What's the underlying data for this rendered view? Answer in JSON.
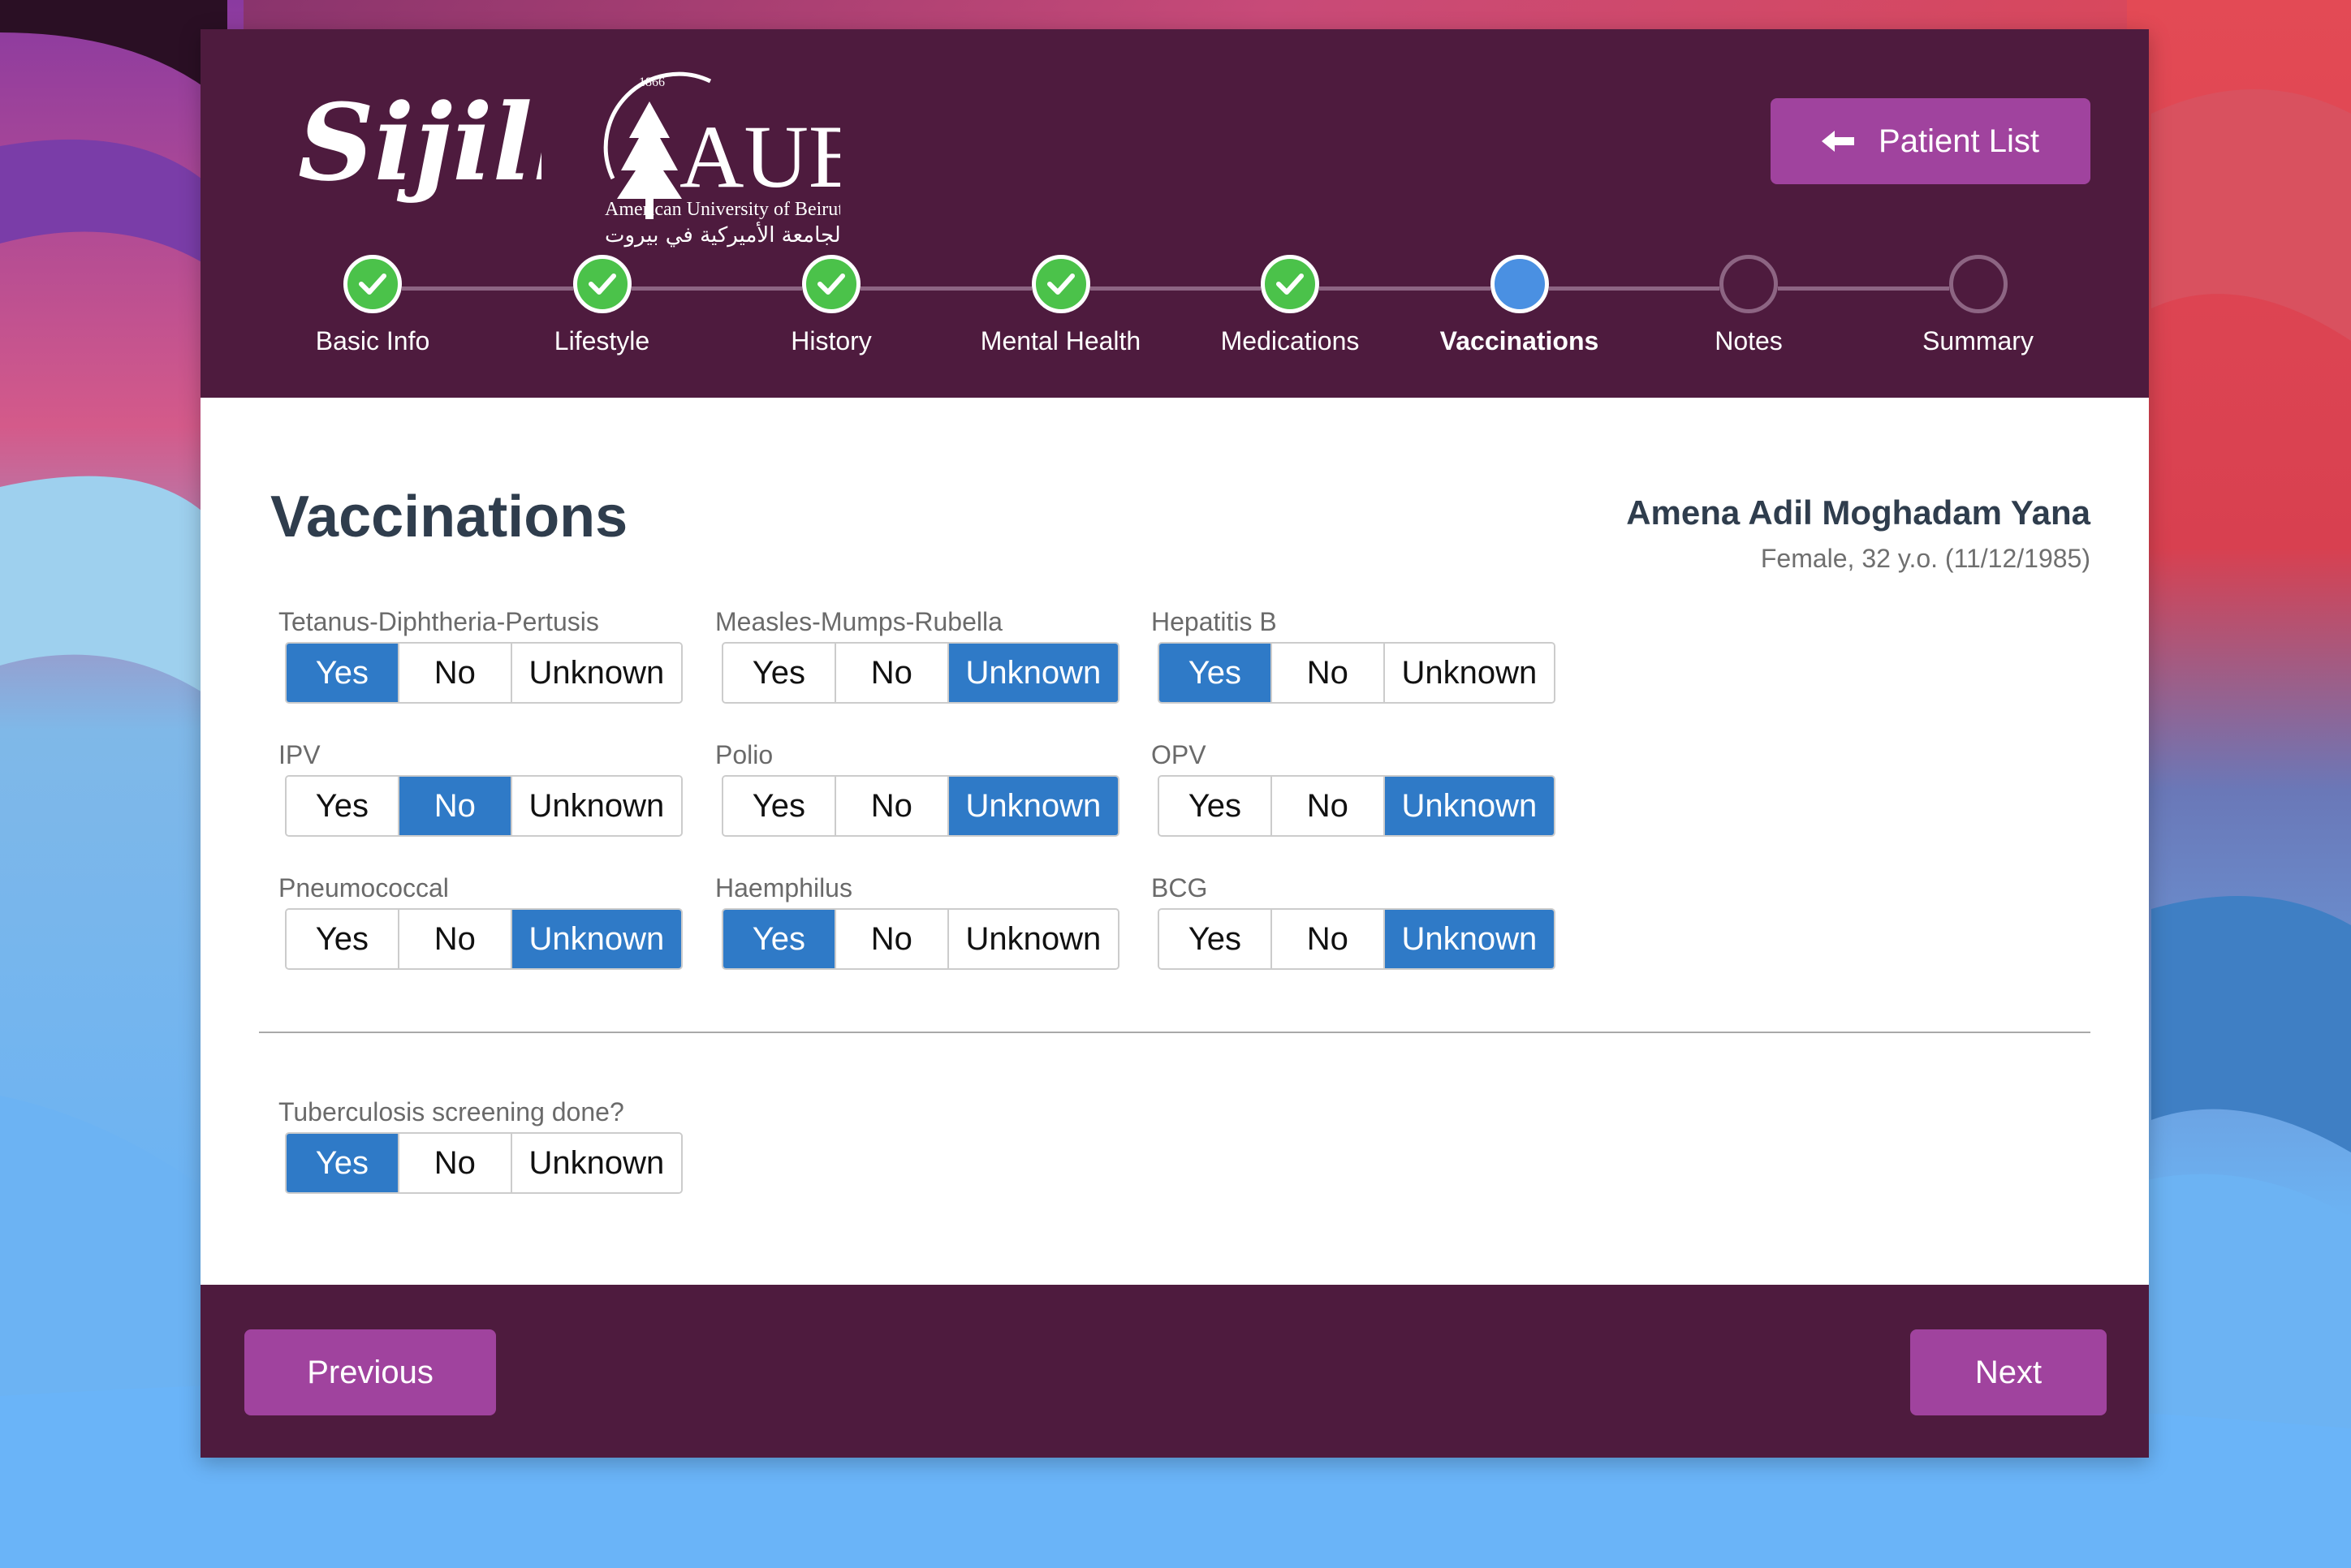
{
  "header": {
    "brand_sijilli": "Sijilli",
    "aub_year": "1866",
    "aub_name": "AUB",
    "aub_full": "American University of Beirut",
    "aub_arabic": "الجامعة الأميركية في بيروت",
    "patient_list_label": "Patient List"
  },
  "steps": [
    {
      "label": "Basic Info",
      "state": "done"
    },
    {
      "label": "Lifestyle",
      "state": "done"
    },
    {
      "label": "History",
      "state": "done"
    },
    {
      "label": "Mental Health",
      "state": "done"
    },
    {
      "label": "Medications",
      "state": "done"
    },
    {
      "label": "Vaccinations",
      "state": "active"
    },
    {
      "label": "Notes",
      "state": "todo"
    },
    {
      "label": "Summary",
      "state": "todo"
    }
  ],
  "page": {
    "title": "Vaccinations",
    "patient_name": "Amena Adil Moghadam Yana",
    "patient_info": "Female, 32 y.o. (11/12/1985)"
  },
  "options": {
    "yes": "Yes",
    "no": "No",
    "unknown": "Unknown"
  },
  "vaccines": [
    {
      "label": "Tetanus-Diphtheria-Pertusis",
      "selected": "yes"
    },
    {
      "label": "Measles-Mumps-Rubella",
      "selected": "unknown"
    },
    {
      "label": "Hepatitis B",
      "selected": "yes"
    },
    {
      "label": "IPV",
      "selected": "no"
    },
    {
      "label": "Polio",
      "selected": "unknown"
    },
    {
      "label": "OPV",
      "selected": "unknown"
    },
    {
      "label": "Pneumococcal",
      "selected": "unknown"
    },
    {
      "label": "Haemphilus",
      "selected": "yes"
    },
    {
      "label": "BCG",
      "selected": "unknown"
    }
  ],
  "tb_screening": {
    "label": "Tuberculosis screening done?",
    "selected": "yes"
  },
  "footer": {
    "previous_label": "Previous",
    "next_label": "Next"
  },
  "colors": {
    "header_bg": "#4e1b3e",
    "button_bg": "#a0439e",
    "selected_bg": "#2f7ac7",
    "step_done": "#4bc24a",
    "step_active": "#4a90e2"
  }
}
